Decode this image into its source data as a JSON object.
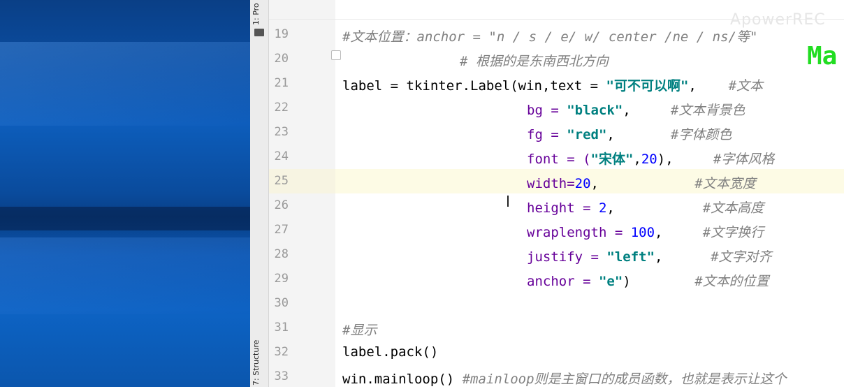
{
  "tool_windows": {
    "project": "1: Pro",
    "structure": "7: Structure"
  },
  "watermark": "ApowerREC",
  "overlay_text": "Ma",
  "editor": {
    "current_line": 25,
    "lines": [
      {
        "num": "19",
        "indent": "",
        "parts": [
          {
            "t": "#文本位置：anchor = \"n / s / e/ w/ center /ne / ns/等\"",
            "c": "cm"
          }
        ]
      },
      {
        "num": "20",
        "indent": "              ",
        "parts": [
          {
            "t": "# 根据的是东南西北方向",
            "c": "cm"
          }
        ]
      },
      {
        "num": "21",
        "indent": "",
        "parts": [
          {
            "t": "label = tkinter.Label(win,text = ",
            "c": ""
          },
          {
            "t": "\"可不可以啊\"",
            "c": "str"
          },
          {
            "t": ",    ",
            "c": ""
          },
          {
            "t": "#文本",
            "c": "cm"
          }
        ]
      },
      {
        "num": "22",
        "indent": "                      ",
        "parts": [
          {
            "t": "bg = ",
            "c": "kw"
          },
          {
            "t": "\"black\"",
            "c": "str"
          },
          {
            "t": ",     ",
            "c": ""
          },
          {
            "t": "#文本背景色",
            "c": "cm"
          }
        ]
      },
      {
        "num": "23",
        "indent": "                      ",
        "parts": [
          {
            "t": "fg = ",
            "c": "kw"
          },
          {
            "t": "\"red\"",
            "c": "str"
          },
          {
            "t": ",       ",
            "c": ""
          },
          {
            "t": "#字体颜色",
            "c": "cm"
          }
        ]
      },
      {
        "num": "24",
        "indent": "                      ",
        "parts": [
          {
            "t": "font = (",
            "c": "kw"
          },
          {
            "t": "\"宋体\"",
            "c": "str"
          },
          {
            "t": ",",
            "c": ""
          },
          {
            "t": "20",
            "c": "nm"
          },
          {
            "t": "),     ",
            "c": ""
          },
          {
            "t": "#字体风格",
            "c": "cm"
          }
        ]
      },
      {
        "num": "25",
        "indent": "                      ",
        "parts": [
          {
            "t": "width=",
            "c": "kw"
          },
          {
            "t": "20",
            "c": "nm"
          },
          {
            "t": ",            ",
            "c": ""
          },
          {
            "t": "#文本宽度",
            "c": "cm"
          }
        ]
      },
      {
        "num": "26",
        "indent": "                      ",
        "parts": [
          {
            "t": "height = ",
            "c": "kw"
          },
          {
            "t": "2",
            "c": "nm"
          },
          {
            "t": ",           ",
            "c": ""
          },
          {
            "t": "#文本高度",
            "c": "cm"
          }
        ]
      },
      {
        "num": "27",
        "indent": "                      ",
        "parts": [
          {
            "t": "wraplength = ",
            "c": "kw"
          },
          {
            "t": "100",
            "c": "nm"
          },
          {
            "t": ",     ",
            "c": ""
          },
          {
            "t": "#文字换行",
            "c": "cm"
          }
        ]
      },
      {
        "num": "28",
        "indent": "                      ",
        "parts": [
          {
            "t": "justify = ",
            "c": "kw"
          },
          {
            "t": "\"left\"",
            "c": "str"
          },
          {
            "t": ",      ",
            "c": ""
          },
          {
            "t": "#文字对齐",
            "c": "cm"
          }
        ]
      },
      {
        "num": "29",
        "indent": "                      ",
        "parts": [
          {
            "t": "anchor = ",
            "c": "kw"
          },
          {
            "t": "\"e\"",
            "c": "str"
          },
          {
            "t": ")        ",
            "c": ""
          },
          {
            "t": "#文本的位置",
            "c": "cm"
          }
        ]
      },
      {
        "num": "30",
        "indent": "",
        "parts": []
      },
      {
        "num": "31",
        "indent": "",
        "parts": [
          {
            "t": "#显示",
            "c": "cm"
          }
        ]
      },
      {
        "num": "32",
        "indent": "",
        "parts": [
          {
            "t": "label.pack()",
            "c": ""
          }
        ]
      },
      {
        "num": "33",
        "indent": "",
        "parts": [
          {
            "t": "win.mainloop() ",
            "c": ""
          },
          {
            "t": "#mainloop则是主窗口的成员函数，也就是表示让这个",
            "c": "cm"
          }
        ]
      }
    ]
  }
}
